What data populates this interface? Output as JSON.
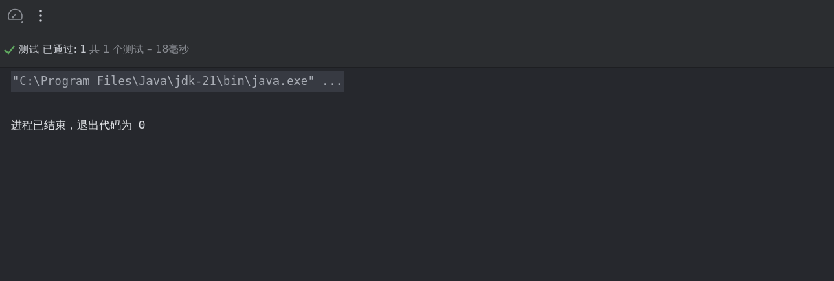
{
  "test_status": {
    "passed": true,
    "label": "测试 已通过: 1",
    "summary": "共 1 个测试 – 18毫秒"
  },
  "console": {
    "lines": [
      {
        "kind": "command",
        "text": "\"C:\\Program Files\\Java\\jdk-21\\bin\\java.exe\" ..."
      },
      {
        "kind": "blank"
      },
      {
        "kind": "output",
        "text": "进程已结束，退出代码为 0"
      }
    ]
  }
}
